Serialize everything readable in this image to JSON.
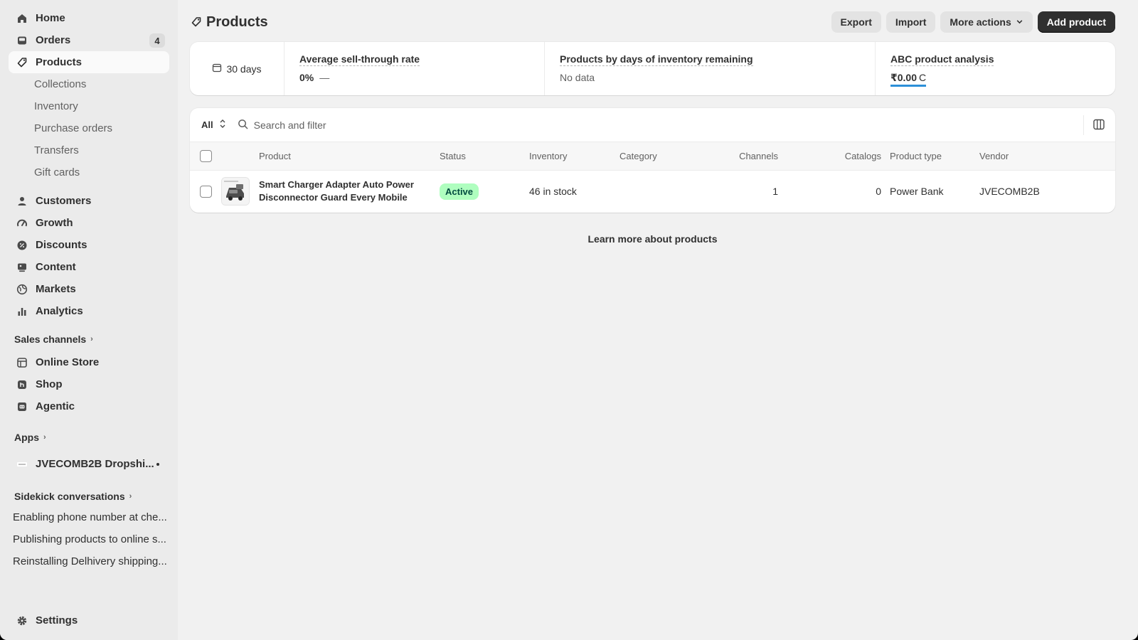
{
  "sidebar": {
    "home": "Home",
    "orders": "Orders",
    "orders_badge": "4",
    "products": "Products",
    "sub": [
      "Collections",
      "Inventory",
      "Purchase orders",
      "Transfers",
      "Gift cards"
    ],
    "main": [
      "Customers",
      "Growth",
      "Discounts",
      "Content",
      "Markets",
      "Analytics"
    ],
    "sales_channels_label": "Sales channels",
    "channels": [
      "Online Store",
      "Shop",
      "Agentic"
    ],
    "apps_label": "Apps",
    "app_name": "JVECOMB2B Dropshi...",
    "sidekick_label": "Sidekick conversations",
    "conversations": [
      "Enabling phone number at che...",
      "Publishing products to online s...",
      "Reinstalling Delhivery shipping..."
    ],
    "settings": "Settings"
  },
  "header": {
    "title": "Products",
    "export": "Export",
    "import": "Import",
    "more_actions": "More actions",
    "add_product": "Add product"
  },
  "metrics": {
    "date_range": "30 days",
    "sell_through_title": "Average sell-through rate",
    "sell_through_value": "0%",
    "sell_through_trend": "—",
    "days_inventory_title": "Products by days of inventory remaining",
    "days_inventory_value": "No data",
    "abc_title": "ABC product analysis",
    "abc_value": "₹0.00",
    "abc_unit": "C"
  },
  "table": {
    "view": "All",
    "search_placeholder": "Search and filter",
    "columns": {
      "product": "Product",
      "status": "Status",
      "inventory": "Inventory",
      "category": "Category",
      "channels": "Channels",
      "catalogs": "Catalogs",
      "product_type": "Product type",
      "vendor": "Vendor"
    },
    "rows": [
      {
        "name": "Smart Charger Adapter Auto Power Disconnector Guard Every Mobile",
        "status": "Active",
        "inventory": "46 in stock",
        "category": "",
        "channels": "1",
        "catalogs": "0",
        "product_type": "Power Bank",
        "vendor": "JVECOMB2B"
      }
    ]
  },
  "footer_link": "Learn more about products",
  "colors": {
    "accent": "#303030",
    "active_status_bg": "#affebf",
    "abc_underline": "#2c8fd8"
  }
}
